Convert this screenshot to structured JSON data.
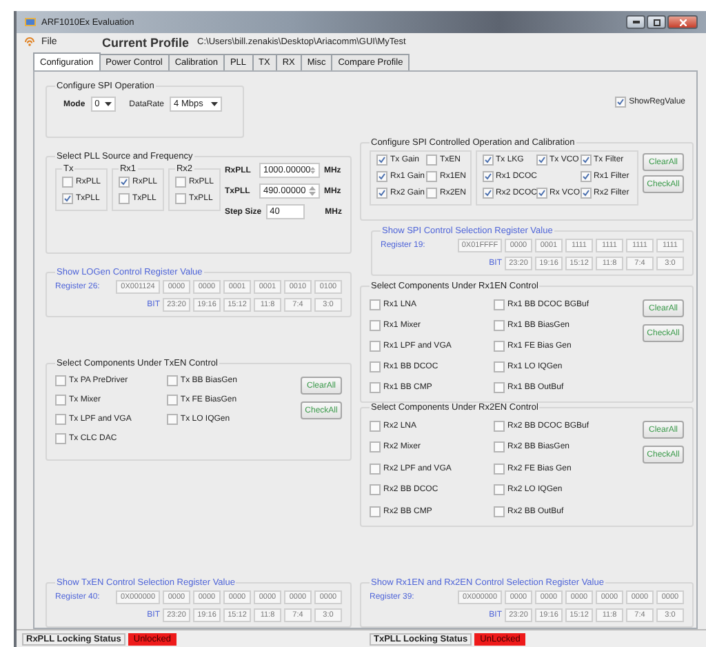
{
  "window": {
    "title": "ARF1010Ex Evaluation"
  },
  "menu": {
    "file": "File",
    "profile_label": "Current Profile",
    "profile_path": "C:\\Users\\bill.zenakis\\Desktop\\Ariacomm\\GUI\\MyTest"
  },
  "tabs": [
    {
      "label": "Configuration",
      "selected": true
    },
    {
      "label": "Power Control",
      "selected": false
    },
    {
      "label": "Calibration",
      "selected": false
    },
    {
      "label": "PLL",
      "selected": false
    },
    {
      "label": "TX",
      "selected": false
    },
    {
      "label": "RX",
      "selected": false
    },
    {
      "label": "Misc",
      "selected": false
    },
    {
      "label": "Compare Profile",
      "selected": false
    }
  ],
  "spi_operation": {
    "title": "Configure SPI Operation",
    "mode_label": "Mode",
    "mode_value": "0",
    "datarate_label": "DataRate",
    "datarate_value": "4 Mbps"
  },
  "show_reg_value": {
    "label": "ShowRegValue",
    "checked": true
  },
  "pll": {
    "title": "Select PLL Source and Frequency",
    "groups": [
      {
        "title": "Tx",
        "options": [
          {
            "label": "RxPLL",
            "checked": false
          },
          {
            "label": "TxPLL",
            "checked": true
          }
        ]
      },
      {
        "title": "Rx1",
        "options": [
          {
            "label": "RxPLL",
            "checked": true
          },
          {
            "label": "TxPLL",
            "checked": false
          }
        ]
      },
      {
        "title": "Rx2",
        "options": [
          {
            "label": "RxPLL",
            "checked": false
          },
          {
            "label": "TxPLL",
            "checked": false
          }
        ]
      }
    ],
    "fields": [
      {
        "kind": "spinner",
        "label": "RxPLL",
        "value": "1000.00000",
        "unit": "MHz"
      },
      {
        "kind": "spinner",
        "label": "TxPLL",
        "value": "490.00000",
        "unit": "MHz"
      },
      {
        "kind": "text",
        "label": "Step Size",
        "value": "40",
        "unit": "MHz"
      }
    ]
  },
  "logen_register": {
    "title": "Show LOGen Control Register Value",
    "register_label": "Register 26:",
    "hex": "0X001124",
    "nibbles": [
      "0000",
      "0000",
      "0001",
      "0001",
      "0010",
      "0100"
    ],
    "bit_label": "BIT",
    "bits": [
      "23:20",
      "19:16",
      "15:12",
      "11:8",
      "7:4",
      "3:0"
    ]
  },
  "txen": {
    "title": "Select Components Under TxEN Control",
    "columns": [
      [
        {
          "label": "Tx PA PreDriver",
          "checked": false
        },
        {
          "label": "Tx Mixer",
          "checked": false
        },
        {
          "label": "Tx LPF and VGA",
          "checked": false
        },
        {
          "label": "Tx CLC DAC",
          "checked": false
        }
      ],
      [
        {
          "label": "Tx BB BiasGen",
          "checked": false
        },
        {
          "label": "Tx FE BiasGen",
          "checked": false
        },
        {
          "label": "Tx LO IQGen",
          "checked": false
        }
      ]
    ],
    "buttons": [
      "ClearAll",
      "CheckAll"
    ]
  },
  "txen_register": {
    "title": "Show TxEN Control Selection Register Value",
    "register_label": "Register 40:",
    "hex": "0X000000",
    "nibbles": [
      "0000",
      "0000",
      "0000",
      "0000",
      "0000",
      "0000"
    ],
    "bit_label": "BIT",
    "bits": [
      "23:20",
      "19:16",
      "15:12",
      "11:8",
      "7:4",
      "3:0"
    ]
  },
  "spi_controlled": {
    "title": "Configure SPI Controlled Operation and  Calibration",
    "left": [
      [
        {
          "label": "Tx Gain",
          "checked": true
        },
        {
          "label": "TxEN",
          "checked": false
        }
      ],
      [
        {
          "label": "Rx1 Gain",
          "checked": true
        },
        {
          "label": "Rx1EN",
          "checked": false
        }
      ],
      [
        {
          "label": "Rx2 Gain",
          "checked": true
        },
        {
          "label": "Rx2EN",
          "checked": false
        }
      ]
    ],
    "right": [
      [
        {
          "label": "Tx LKG",
          "checked": true
        },
        {
          "label": "Tx VCO",
          "checked": true
        },
        {
          "label": "Tx Filter",
          "checked": true
        }
      ],
      [
        {
          "label": "Rx1 DCOC",
          "checked": true,
          "kind": "wide"
        },
        {
          "label": "Rx1 Filter",
          "checked": true
        }
      ],
      [
        {
          "label": "Rx2 DCOC",
          "checked": true
        },
        {
          "label": "Rx VCO",
          "checked": true
        },
        {
          "label": "Rx2 Filter",
          "checked": true
        }
      ]
    ],
    "buttons": [
      "ClearAll",
      "CheckAll"
    ]
  },
  "spi_register": {
    "title": "Show SPI Control Selection Register Value",
    "register_label": "Register 19:",
    "hex": "0X01FFFF",
    "nibbles": [
      "0000",
      "0001",
      "1111",
      "1111",
      "1111",
      "1111"
    ],
    "bit_label": "BIT",
    "bits": [
      "23:20",
      "19:16",
      "15:12",
      "11:8",
      "7:4",
      "3:0"
    ]
  },
  "rx1en": {
    "title": "Select Components Under Rx1EN Control",
    "columns": [
      [
        {
          "label": "Rx1 LNA",
          "checked": false
        },
        {
          "label": "Rx1 Mixer",
          "checked": false
        },
        {
          "label": "Rx1 LPF and VGA",
          "checked": false
        },
        {
          "label": "Rx1 BB DCOC",
          "checked": false
        },
        {
          "label": "Rx1 BB CMP",
          "checked": false
        }
      ],
      [
        {
          "label": "Rx1 BB DCOC BGBuf",
          "checked": false
        },
        {
          "label": "Rx1 BB BiasGen",
          "checked": false
        },
        {
          "label": "Rx1 FE Bias Gen",
          "checked": false
        },
        {
          "label": "Rx1 LO IQGen",
          "checked": false
        },
        {
          "label": "Rx1 BB OutBuf",
          "checked": false
        }
      ]
    ],
    "buttons": [
      "ClearAll",
      "CheckAll"
    ]
  },
  "rx2en": {
    "title": "Select Components Under Rx2EN Control",
    "columns": [
      [
        {
          "label": "Rx2 LNA",
          "checked": false
        },
        {
          "label": "Rx2 Mixer",
          "checked": false
        },
        {
          "label": "Rx2 LPF and VGA",
          "checked": false
        },
        {
          "label": "Rx2 BB DCOC",
          "checked": false
        },
        {
          "label": "Rx2 BB CMP",
          "checked": false
        }
      ],
      [
        {
          "label": "Rx2 BB DCOC BGBuf",
          "checked": false
        },
        {
          "label": "Rx2 BB BiasGen",
          "checked": false
        },
        {
          "label": "Rx2 FE Bias Gen",
          "checked": false
        },
        {
          "label": "Rx2 LO IQGen",
          "checked": false
        },
        {
          "label": "Rx2 BB OutBuf",
          "checked": false
        }
      ]
    ],
    "buttons": [
      "ClearAll",
      "CheckAll"
    ]
  },
  "rx_register": {
    "title": "Show Rx1EN and Rx2EN Control Selection Register Value",
    "register_label": "Register 39:",
    "hex": "0X000000",
    "nibbles": [
      "0000",
      "0000",
      "0000",
      "0000",
      "0000",
      "0000"
    ],
    "bit_label": "BIT",
    "bits": [
      "23:20",
      "19:16",
      "15:12",
      "11:8",
      "7:4",
      "3:0"
    ]
  },
  "status_bar": [
    {
      "label": "RxPLL Locking Status",
      "value": "Unlocked",
      "locked": false
    },
    {
      "label": "TxPLL Locking Status",
      "value": "UnLocked",
      "locked": false
    }
  ]
}
